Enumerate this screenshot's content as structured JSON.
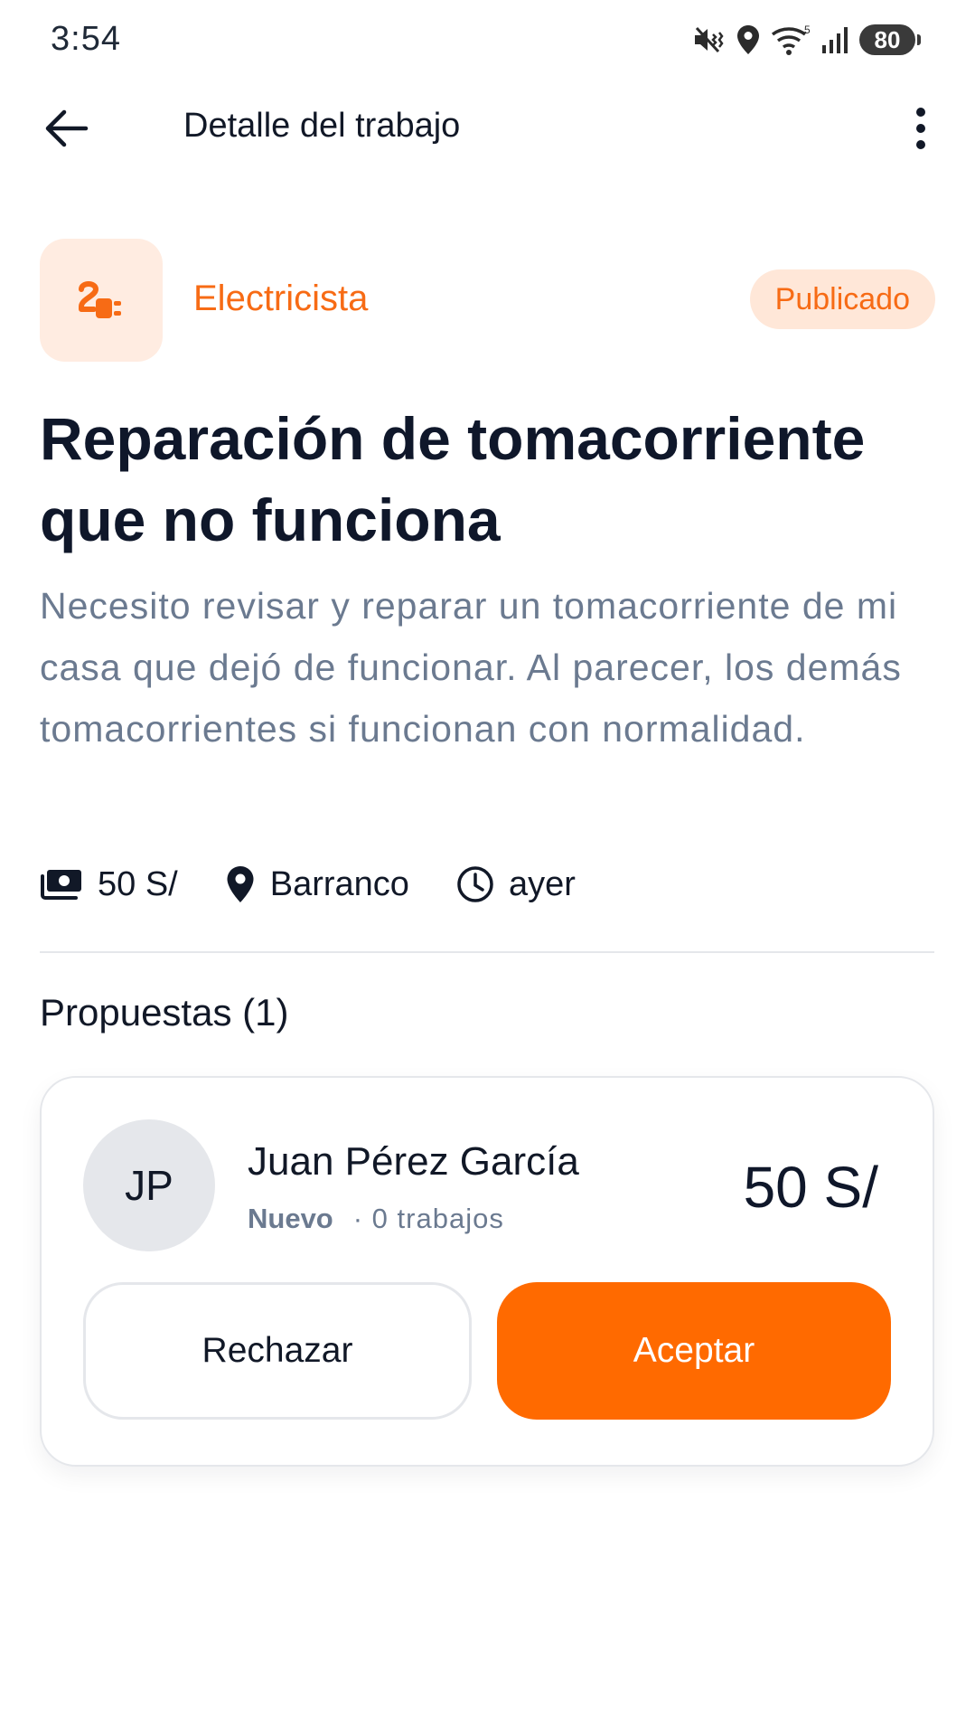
{
  "status_bar": {
    "time": "3:54",
    "network_label": "5",
    "battery": "80",
    "icons": [
      "mute-vibrate-icon",
      "location-icon",
      "wifi-icon",
      "signal-icon",
      "battery-icon"
    ]
  },
  "app_bar": {
    "title": "Detalle del trabajo",
    "back_icon": "arrow-left-icon",
    "menu_icon": "more-vertical-icon"
  },
  "job": {
    "category": "Electricista",
    "category_icon": "electric-plug-icon",
    "status": "Publicado",
    "title": "Reparación de tomacorriente que no funciona",
    "description": "Necesito revisar y reparar un tomacorriente de mi casa que dejó de funcionar. Al parecer, los demás tomacorrientes si funcionan con normalidad.",
    "budget": "50 S/",
    "location": "Barranco",
    "posted": "ayer"
  },
  "proposals": {
    "heading": "Propuestas (1)",
    "items": [
      {
        "initials": "JP",
        "name": "Juan Pérez García",
        "level": "Nuevo",
        "jobs": "· 0 trabajos",
        "price": "50 S/",
        "reject_label": "Rechazar",
        "accept_label": "Aceptar"
      }
    ]
  },
  "colors": {
    "accent": "#ff6a00",
    "accent_text": "#f76b15",
    "accent_soft": "#ffe7d8",
    "muted_text": "#6b7a90"
  }
}
